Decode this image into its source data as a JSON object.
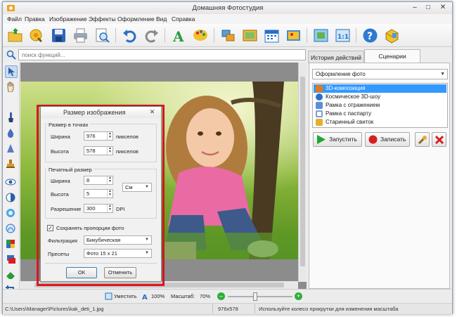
{
  "window": {
    "title": "Домашняя Фотостудия"
  },
  "menu": [
    "Файл",
    "Правка",
    "Изображение",
    "Эффекты",
    "Оформление",
    "Вид",
    "Справка"
  ],
  "toolbar": {
    "icons": [
      "open-folder-icon",
      "open-image-icon",
      "save-icon",
      "print-icon",
      "preview-icon",
      "undo-icon",
      "redo-icon",
      "text-icon",
      "palette-icon",
      "collage-icon",
      "frame-icon",
      "calendar-icon",
      "postcard-icon",
      "fit-window-icon",
      "actual-size-icon",
      "help-icon",
      "box-icon"
    ]
  },
  "search": {
    "placeholder": "поиск функций..."
  },
  "right_panel": {
    "tabs": [
      "История действий",
      "Сценарии"
    ],
    "active_tab": "Сценарии",
    "scenario_combo": "Оформление фото",
    "scenarios": [
      {
        "label": "3D-композиция",
        "selected": true,
        "color": "#e07a1f"
      },
      {
        "label": "Космическое 3D-шоу",
        "selected": false,
        "color": "#2a6fc7"
      },
      {
        "label": "Рамка с отражением",
        "selected": false,
        "color": "#5a8fd6"
      },
      {
        "label": "Рамка с паспарту",
        "selected": false,
        "color": "#7a9fcf"
      },
      {
        "label": "Старинный свиток",
        "selected": false,
        "color": "#e2b12a"
      }
    ],
    "run_label": "Запустить",
    "record_label": "Записать"
  },
  "dialog": {
    "title": "Размер изображения",
    "pixels_group": "Размер в точках",
    "width_label": "Ширина",
    "width_value": "976",
    "height_label": "Высота",
    "height_value": "578",
    "pixel_unit": "пикселов",
    "print_group": "Печатный размер",
    "print_width_label": "Ширина",
    "print_width_value": "8",
    "print_height_label": "Высота",
    "print_height_value": "5",
    "unit_combo": "См",
    "resolution_label": "Разрешение",
    "resolution_value": "300",
    "resolution_unit": "DPI",
    "keep_proportions_label": "Сохранять пропорции фото",
    "keep_proportions_checked": true,
    "filter_label": "Фильтрация",
    "filter_value": "Бикубическая",
    "presets_label": "Пресеты",
    "presets_value": "Фото 15 x 21",
    "ok_label": "ОК",
    "cancel_label": "Отменить"
  },
  "statusbar": {
    "fit_label": "Уместить",
    "zoom_100_label": "100%",
    "scale_label": "Масштаб:",
    "scale_value": "70%",
    "scale_fraction": 0.7
  },
  "footer": {
    "path": "C:\\Users\\Manager\\Pictures\\kak_deti_1.jpg",
    "dimensions": "976x578",
    "hint": "Используйте колесо прокрутки для изменения масштаба"
  },
  "colors": {
    "highlight": "#3399ff",
    "dialog_frame": "#e0171f",
    "run_green": "#1fa531",
    "record_red": "#d61f1f"
  }
}
